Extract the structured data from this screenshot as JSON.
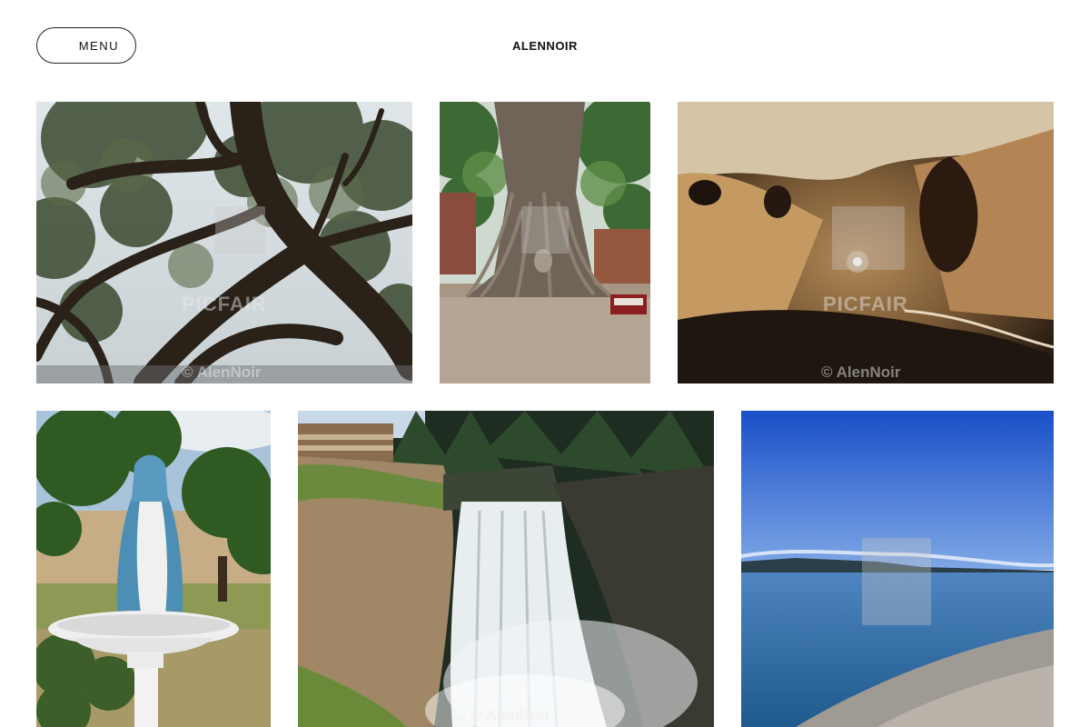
{
  "header": {
    "menu_label": "MENU",
    "brand": "ALENNOIR"
  },
  "watermark": {
    "site": "PICFAIR",
    "copyright": "© AlenNoir"
  },
  "gallery": {
    "photos": [
      {
        "subject": "oak tree branches"
      },
      {
        "subject": "buddha head in tree roots"
      },
      {
        "subject": "cave interior"
      },
      {
        "subject": "virgin mary statue"
      },
      {
        "subject": "waterfall with lodge"
      },
      {
        "subject": "bay shoreline"
      }
    ]
  },
  "colors": {
    "background": "#ffffff",
    "text": "#111111"
  }
}
